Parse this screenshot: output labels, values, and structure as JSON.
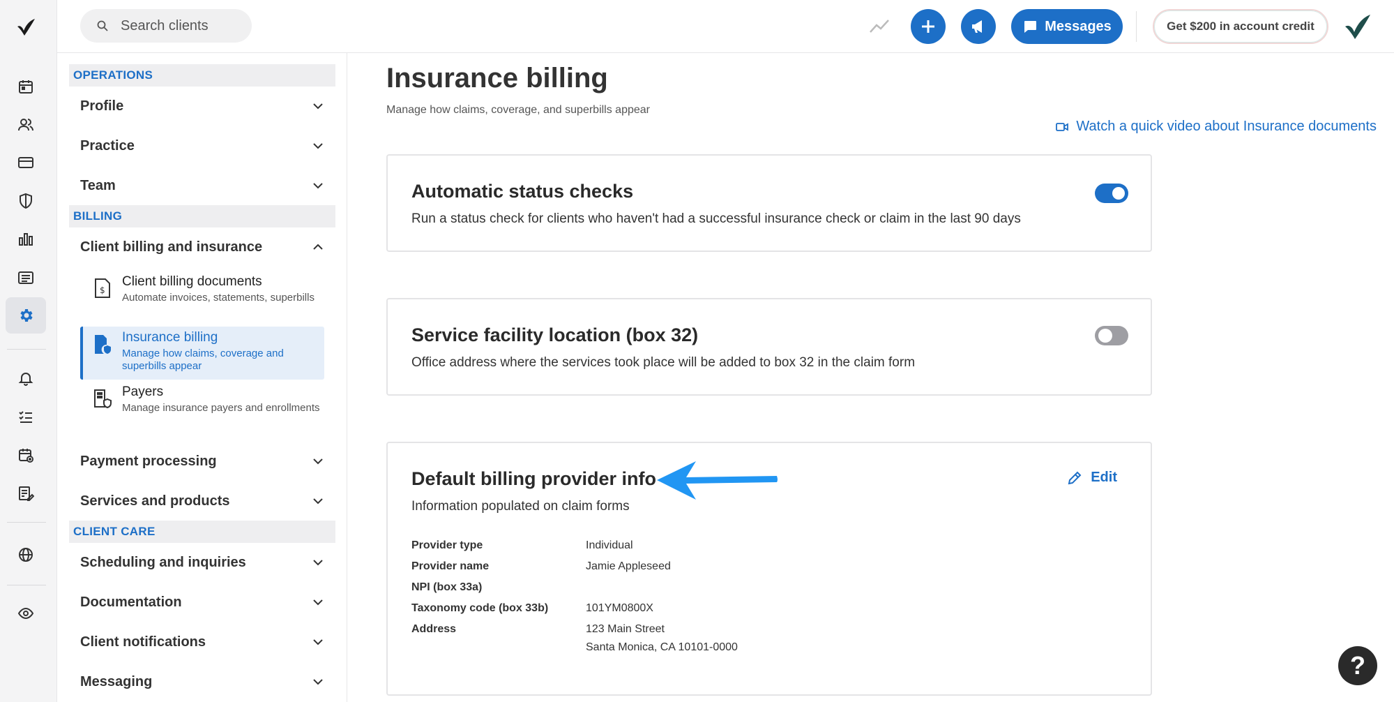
{
  "topbar": {
    "search_placeholder": "Search clients",
    "messages_label": "Messages",
    "credit_label": "Get $200 in account credit"
  },
  "sidebar": {
    "sections": [
      {
        "heading": "OPERATIONS"
      },
      {
        "heading": "BILLING"
      },
      {
        "heading": "CLIENT CARE"
      }
    ],
    "operations_items": [
      "Profile",
      "Practice",
      "Team"
    ],
    "billing_item": "Client billing and insurance",
    "billing_sub": [
      {
        "title": "Client billing documents",
        "desc": "Automate invoices, statements, superbills"
      },
      {
        "title": "Insurance billing",
        "desc": "Manage how claims, coverage and superbills appear"
      },
      {
        "title": "Payers",
        "desc": "Manage insurance payers and enrollments"
      }
    ],
    "billing_more": [
      "Payment processing",
      "Services and products"
    ],
    "client_care_items": [
      "Scheduling and inquiries",
      "Documentation",
      "Client notifications",
      "Messaging"
    ]
  },
  "main": {
    "title": "Insurance billing",
    "subtitle": "Manage how claims, coverage, and superbills appear",
    "video_link": "Watch a quick video about Insurance documents",
    "cards": [
      {
        "title": "Automatic status checks",
        "desc": "Run a status check for clients who haven't had a successful insurance check or claim in the last 90 days",
        "toggle": "on"
      },
      {
        "title": "Service facility location (box 32)",
        "desc": "Office address where the services took place will be added to box 32 in the claim form",
        "toggle": "off"
      }
    ],
    "provider_card": {
      "title": "Default billing provider info",
      "desc": "Information populated on claim forms",
      "edit_label": "Edit",
      "rows": [
        {
          "k": "Provider type",
          "v": "Individual"
        },
        {
          "k": "Provider name",
          "v": "Jamie Appleseed"
        },
        {
          "k": "NPI (box 33a)",
          "v": ""
        },
        {
          "k": "Taxonomy code (box 33b)",
          "v": "101YM0800X"
        },
        {
          "k": "Address",
          "v": "123 Main Street"
        },
        {
          "k": "",
          "v": "Santa Monica, CA 10101-0000"
        }
      ]
    }
  },
  "help_label": "?",
  "colors": {
    "accent": "#1d6fc7",
    "arrow": "#2196f3"
  }
}
